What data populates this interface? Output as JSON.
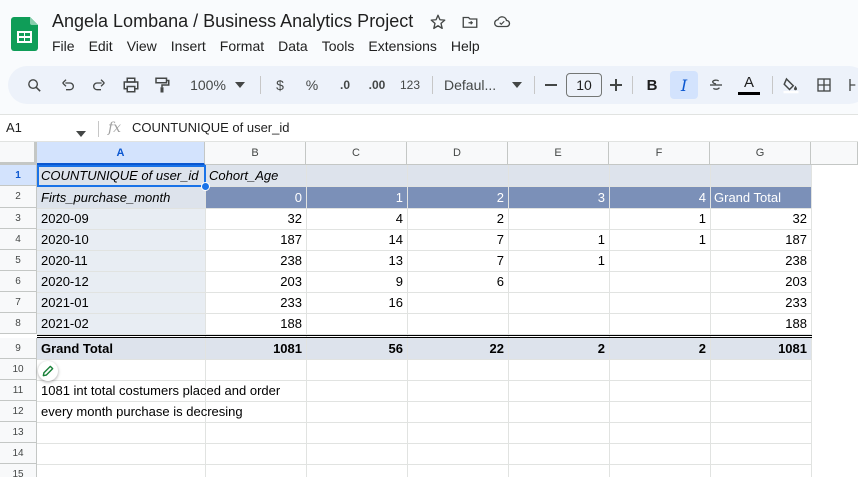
{
  "app": {
    "doc_title": "Angela Lombana / Business Analytics Project",
    "menu": [
      "File",
      "Edit",
      "View",
      "Insert",
      "Format",
      "Data",
      "Tools",
      "Extensions",
      "Help"
    ]
  },
  "toolbar": {
    "zoom": "100%",
    "currency": "$",
    "percent": "%",
    "decrease_decimal": ".0",
    "increase_decimal": ".00",
    "number_format": "123",
    "font": "Defaul...",
    "font_size": "10",
    "bold": "B",
    "italic": "I",
    "text_color": "A"
  },
  "formula_bar": {
    "cell_ref": "A1",
    "fx": "fx",
    "content": "COUNTUNIQUE of user_id"
  },
  "columns": [
    "A",
    "B",
    "C",
    "D",
    "E",
    "F",
    "G"
  ],
  "rows": [
    "1",
    "2",
    "3",
    "4",
    "5",
    "6",
    "7",
    "8",
    "9",
    "10",
    "11",
    "12",
    "13",
    "14",
    "15"
  ],
  "pivot": {
    "corner_label": "COUNTUNIQUE of user_id",
    "cohort_label": "Cohort_Age",
    "row_label": "Firts_purchase_month",
    "headers": [
      "0",
      "1",
      "2",
      "3",
      "4",
      "Grand Total"
    ],
    "data_rows": [
      {
        "month": "2020-09",
        "values": [
          "32",
          "4",
          "2",
          "",
          "1",
          "32"
        ]
      },
      {
        "month": "2020-10",
        "values": [
          "187",
          "14",
          "7",
          "1",
          "1",
          "187"
        ]
      },
      {
        "month": "2020-11",
        "values": [
          "238",
          "13",
          "7",
          "1",
          "",
          "238"
        ]
      },
      {
        "month": "2020-12",
        "values": [
          "203",
          "9",
          "6",
          "",
          "",
          "203"
        ]
      },
      {
        "month": "2021-01",
        "values": [
          "233",
          "16",
          "",
          "",
          "",
          "233"
        ]
      },
      {
        "month": "2021-02",
        "values": [
          "188",
          "",
          "",
          "",
          "",
          "188"
        ]
      }
    ],
    "total_label": "Grand Total",
    "totals": [
      "1081",
      "56",
      "22",
      "2",
      "2",
      "1081"
    ]
  },
  "notes": [
    "1081 int total costumers placed and order",
    "every month purchase is decresing"
  ],
  "colors": {
    "accent": "#0b57d0",
    "header_band": "#7b90b8",
    "light_band": "#dde3ec"
  }
}
